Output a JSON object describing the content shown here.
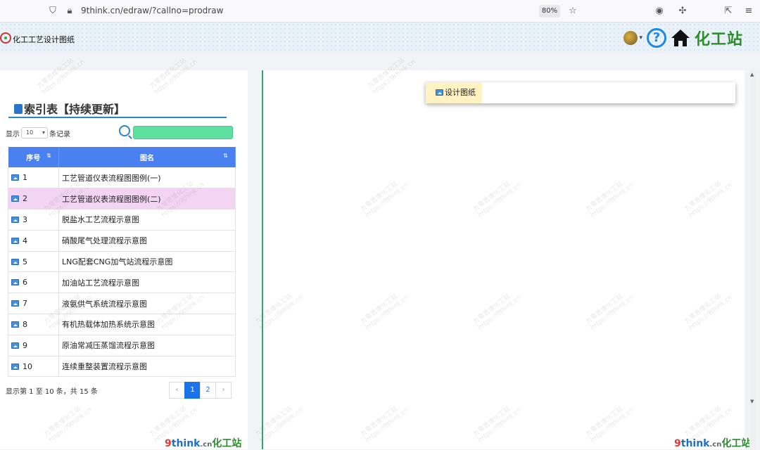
{
  "browser": {
    "url": "9think.cn/edraw/?callno=prodraw",
    "zoom": "80%"
  },
  "header": {
    "app_title": "化工工艺设计图纸",
    "help_glyph": "?",
    "brand": "化工站"
  },
  "index": {
    "title": "索引表【持续更新】",
    "length_prefix": "显示",
    "length_value": "10",
    "length_suffix": "条记录",
    "columns": [
      "序号",
      "图名"
    ],
    "rows": [
      {
        "no": "1",
        "name": "工艺管道仪表流程图图例(一)"
      },
      {
        "no": "2",
        "name": "工艺管道仪表流程图图例(二)"
      },
      {
        "no": "3",
        "name": "脱盐水工艺流程示意图"
      },
      {
        "no": "4",
        "name": "硝酸尾气处理流程示意图"
      },
      {
        "no": "5",
        "name": "LNG配套CNG加气站流程示意图"
      },
      {
        "no": "6",
        "name": "加油站工艺流程示意图"
      },
      {
        "no": "7",
        "name": "液氨供气系统流程示意图"
      },
      {
        "no": "8",
        "name": "有机热载体加热系统示意图"
      },
      {
        "no": "9",
        "name": "原油常减压蒸馏流程示意图"
      },
      {
        "no": "10",
        "name": "连续重整装置流程示意图"
      }
    ],
    "highlight_row": 2,
    "info": "显示第 1 至 10 条，共 15 条",
    "pager": {
      "prev": "‹",
      "pages": [
        "1",
        "2"
      ],
      "next": "›",
      "active": "1"
    }
  },
  "right": {
    "tab_label": "设计图纸"
  },
  "footer": {
    "nine": "9",
    "think": "think",
    "cn": ".cn",
    "zh": "化工站"
  },
  "watermark": [
    "九零思维化工站",
    "https://9think.cn"
  ],
  "colors": {
    "accent": "#4a80f0",
    "search_fill": "#5ee0a0",
    "highlight_row": "#f3d4f3",
    "brand_green": "#2e8b2e"
  }
}
